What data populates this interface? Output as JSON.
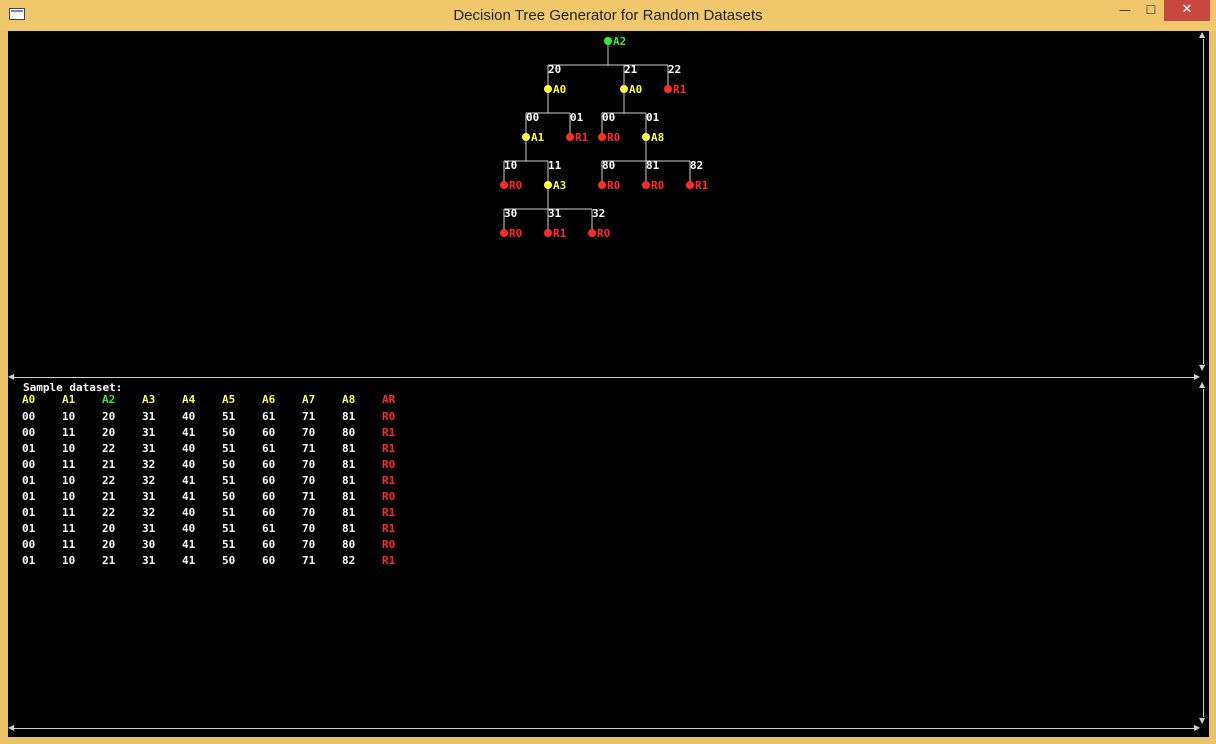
{
  "window": {
    "title": "Decision Tree Generator for Random Datasets"
  },
  "colors": {
    "white": "#ffffff",
    "yellow": "#ffff33",
    "green": "#33ee33",
    "red": "#ff2a2a",
    "edge": "#cfcfcf"
  },
  "tree": {
    "root": "A2",
    "nodes": {
      "A2": {
        "label": "A2",
        "color": "green"
      },
      "n20": {
        "label": "A0",
        "color": "yellow"
      },
      "n21": {
        "label": "A0",
        "color": "yellow"
      },
      "n22": {
        "label": "R1",
        "color": "red"
      },
      "n20_00": {
        "label": "A1",
        "color": "yellow"
      },
      "n20_01": {
        "label": "R1",
        "color": "red"
      },
      "n21_00": {
        "label": "R0",
        "color": "red"
      },
      "n21_01": {
        "label": "A8",
        "color": "yellow"
      },
      "n10": {
        "label": "R0",
        "color": "red"
      },
      "n11": {
        "label": "A3",
        "color": "yellow"
      },
      "n80": {
        "label": "R0",
        "color": "red"
      },
      "n81": {
        "label": "R0",
        "color": "red"
      },
      "n82": {
        "label": "R1",
        "color": "red"
      },
      "n30": {
        "label": "R0",
        "color": "red"
      },
      "n31": {
        "label": "R1",
        "color": "red"
      },
      "n32": {
        "label": "R0",
        "color": "red"
      }
    },
    "edges": [
      {
        "from": "A2",
        "to": "n20",
        "value": "20"
      },
      {
        "from": "A2",
        "to": "n21",
        "value": "21"
      },
      {
        "from": "A2",
        "to": "n22",
        "value": "22"
      },
      {
        "from": "n20",
        "to": "n20_00",
        "value": "00"
      },
      {
        "from": "n20",
        "to": "n20_01",
        "value": "01"
      },
      {
        "from": "n21",
        "to": "n21_00",
        "value": "00"
      },
      {
        "from": "n21",
        "to": "n21_01",
        "value": "01"
      },
      {
        "from": "n20_00",
        "to": "n10",
        "value": "10"
      },
      {
        "from": "n20_00",
        "to": "n11",
        "value": "11"
      },
      {
        "from": "n21_01",
        "to": "n80",
        "value": "80"
      },
      {
        "from": "n21_01",
        "to": "n81",
        "value": "81"
      },
      {
        "from": "n21_01",
        "to": "n82",
        "value": "82"
      },
      {
        "from": "n11",
        "to": "n30",
        "value": "30"
      },
      {
        "from": "n11",
        "to": "n31",
        "value": "31"
      },
      {
        "from": "n11",
        "to": "n32",
        "value": "32"
      }
    ]
  },
  "dataset": {
    "heading": "Sample dataset:",
    "columns": [
      {
        "label": "A0",
        "color": "yellow"
      },
      {
        "label": "A1",
        "color": "yellow"
      },
      {
        "label": "A2",
        "color": "green"
      },
      {
        "label": "A3",
        "color": "yellow"
      },
      {
        "label": "A4",
        "color": "yellow"
      },
      {
        "label": "A5",
        "color": "yellow"
      },
      {
        "label": "A6",
        "color": "yellow"
      },
      {
        "label": "A7",
        "color": "yellow"
      },
      {
        "label": "A8",
        "color": "yellow"
      },
      {
        "label": "AR",
        "color": "red"
      }
    ],
    "rows": [
      [
        "00",
        "10",
        "20",
        "31",
        "40",
        "51",
        "61",
        "71",
        "81",
        "R0"
      ],
      [
        "00",
        "11",
        "20",
        "31",
        "41",
        "50",
        "60",
        "70",
        "80",
        "R1"
      ],
      [
        "01",
        "10",
        "22",
        "31",
        "40",
        "51",
        "61",
        "71",
        "81",
        "R1"
      ],
      [
        "00",
        "11",
        "21",
        "32",
        "40",
        "50",
        "60",
        "70",
        "81",
        "R0"
      ],
      [
        "01",
        "10",
        "22",
        "32",
        "41",
        "51",
        "60",
        "70",
        "81",
        "R1"
      ],
      [
        "01",
        "10",
        "21",
        "31",
        "41",
        "50",
        "60",
        "71",
        "81",
        "R0"
      ],
      [
        "01",
        "11",
        "22",
        "32",
        "40",
        "51",
        "60",
        "70",
        "81",
        "R1"
      ],
      [
        "01",
        "11",
        "20",
        "31",
        "40",
        "51",
        "61",
        "70",
        "81",
        "R1"
      ],
      [
        "00",
        "11",
        "20",
        "30",
        "41",
        "51",
        "60",
        "70",
        "80",
        "R0"
      ],
      [
        "01",
        "10",
        "21",
        "31",
        "41",
        "50",
        "60",
        "71",
        "82",
        "R1"
      ]
    ]
  },
  "icons": {
    "minimize": "—",
    "maximize": "☐",
    "close": "✕",
    "arrow_up": "▲",
    "arrow_down": "▼",
    "arrow_left": "◀",
    "arrow_right": "▶"
  }
}
